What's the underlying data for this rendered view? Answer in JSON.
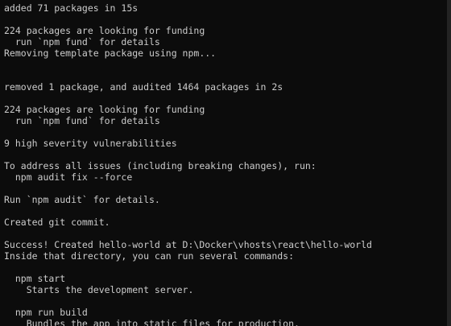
{
  "terminal": {
    "lines": [
      "added 71 packages in 15s",
      "",
      "224 packages are looking for funding",
      "  run `npm fund` for details",
      "Removing template package using npm...",
      "",
      "",
      "removed 1 package, and audited 1464 packages in 2s",
      "",
      "224 packages are looking for funding",
      "  run `npm fund` for details",
      "",
      "9 high severity vulnerabilities",
      "",
      "To address all issues (including breaking changes), run:",
      "  npm audit fix --force",
      "",
      "Run `npm audit` for details.",
      "",
      "Created git commit.",
      "",
      "Success! Created hello-world at D:\\Docker\\vhosts\\react\\hello-world",
      "Inside that directory, you can run several commands:",
      "",
      "  npm start",
      "    Starts the development server.",
      "",
      "  npm run build",
      "    Bundles the app into static files for production."
    ]
  }
}
